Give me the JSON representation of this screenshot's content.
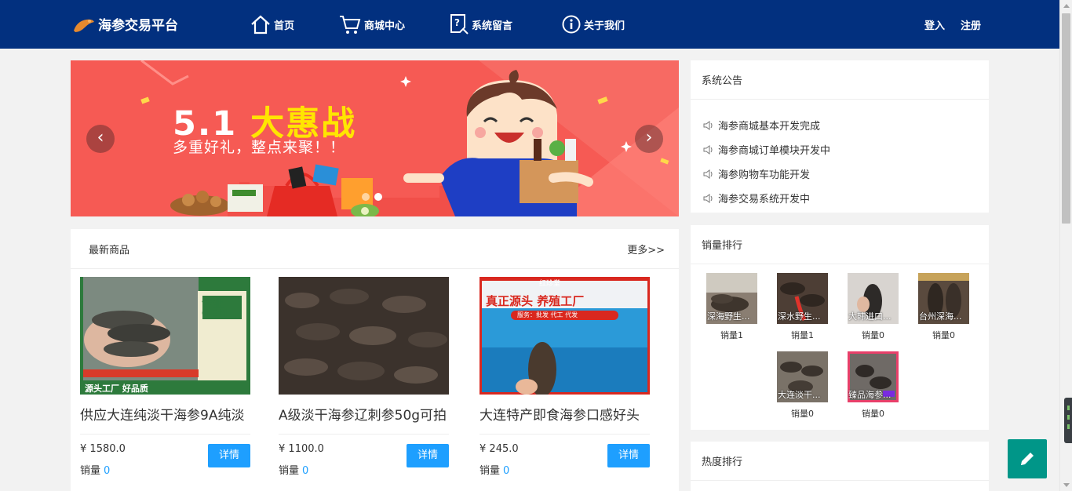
{
  "header": {
    "logo_text": "海参交易平台",
    "nav": [
      {
        "label": "首页",
        "icon": "home-icon"
      },
      {
        "label": "商城中心",
        "icon": "cart-icon"
      },
      {
        "label": "系统留言",
        "icon": "message-icon"
      },
      {
        "label": "关于我们",
        "icon": "info-icon"
      }
    ],
    "login": "登入",
    "register": "注册"
  },
  "banner": {
    "headline_num": "5.1",
    "headline_word": "大惠战",
    "subtitle": "多重好礼，整点来聚！！",
    "prev": "‹",
    "next": "›",
    "slides": 2,
    "active_slide": 2
  },
  "notice": {
    "title": "系统公告",
    "items": [
      "海参商城基本开发完成",
      "海参商城订单模块开发中",
      "海参购物车功能开发",
      "海参交易系统开发中"
    ]
  },
  "sales_rank": {
    "title": "销量排行",
    "items": [
      {
        "name": "深海野生...",
        "sales": "销量1"
      },
      {
        "name": "深水野生...",
        "sales": "销量1"
      },
      {
        "name": "大韩进口...",
        "sales": "销量0"
      },
      {
        "name": "台州深海...",
        "sales": "销量0"
      },
      {
        "name": "大连淡干...",
        "sales": "销量0"
      },
      {
        "name": "臻品海参...",
        "sales": "销量0"
      }
    ]
  },
  "hot_rank": {
    "title": "热度排行"
  },
  "latest": {
    "title": "最新商品",
    "more": "更多>>",
    "products": [
      {
        "title": "供应大连纯淡干海参9A纯淡",
        "currency": "¥",
        "price": "1580.0",
        "sold_label": "销量",
        "sold": "0",
        "button": "详情",
        "img_text_1": "专业",
        "img_text_2": "OEM",
        "img_text_3": "源头工厂 好品质"
      },
      {
        "title": "A级淡干海参辽刺参50g可拍",
        "currency": "¥",
        "price": "1100.0",
        "sold_label": "销量",
        "sold": "0",
        "button": "详情"
      },
      {
        "title": "大连特产即食海参口感好头",
        "currency": "¥",
        "price": "245.0",
        "sold_label": "销量",
        "sold": "0",
        "button": "详情",
        "img_text_1": "红珍堂",
        "img_text_2": "真正源头 养殖工厂",
        "img_text_3": "服务：批发 代工 代发"
      }
    ]
  },
  "colors": {
    "header": "#02307f",
    "accent": "#1e9fff",
    "fab": "#009688",
    "banner": "#f65a54"
  }
}
